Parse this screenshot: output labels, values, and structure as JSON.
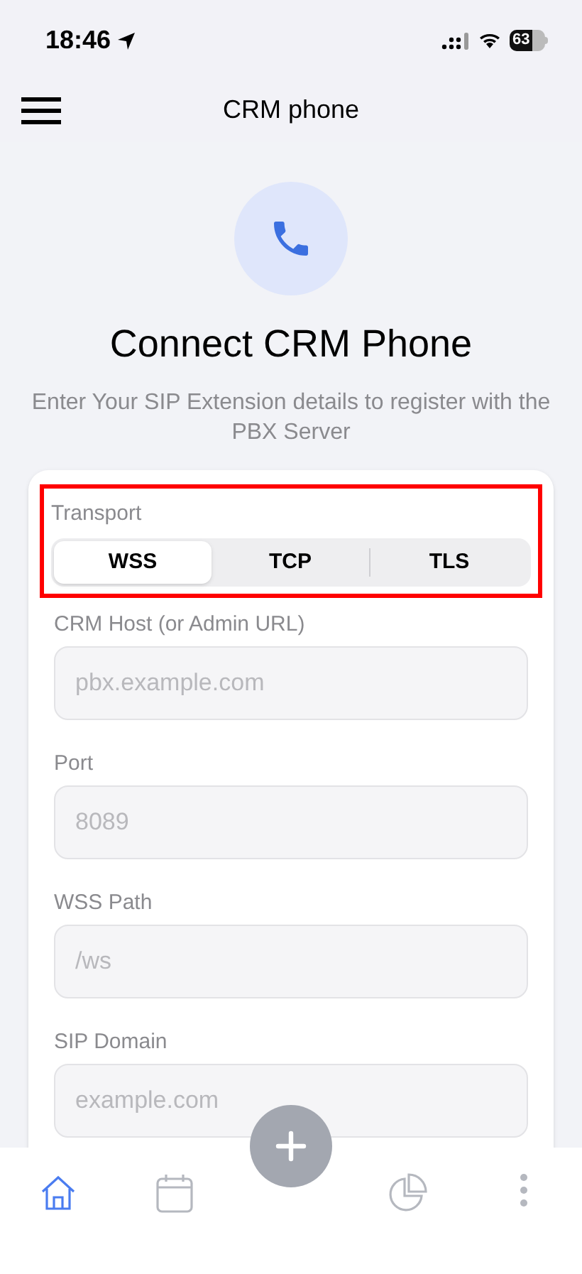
{
  "status_bar": {
    "time": "18:46",
    "battery": "63"
  },
  "header": {
    "title": "CRM phone"
  },
  "hero": {
    "title": "Connect CRM Phone",
    "subtitle": "Enter Your SIP Extension details to register with the PBX Server"
  },
  "transport": {
    "label": "Transport",
    "highlighted": true,
    "options": [
      {
        "label": "WSS",
        "selected": true
      },
      {
        "label": "TCP",
        "selected": false
      },
      {
        "label": "TLS",
        "selected": false
      }
    ]
  },
  "fields": [
    {
      "label": "CRM Host (or Admin URL)",
      "placeholder": "pbx.example.com"
    },
    {
      "label": "Port",
      "placeholder": "8089"
    },
    {
      "label": "WSS Path",
      "placeholder": "/ws"
    },
    {
      "label": "SIP Domain",
      "placeholder": "example.com"
    }
  ],
  "tab_bar": {
    "items": [
      {
        "kind": "home",
        "selected": true
      },
      {
        "kind": "calendar",
        "selected": false
      },
      {
        "kind": "add",
        "selected": false
      },
      {
        "kind": "chart",
        "selected": false
      },
      {
        "kind": "more",
        "selected": false
      }
    ]
  }
}
